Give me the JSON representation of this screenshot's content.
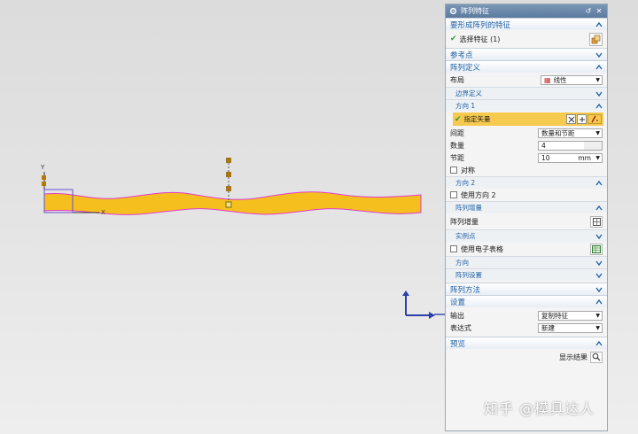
{
  "dialog": {
    "title": "阵列特征",
    "sections": {
      "features_to_pattern": "要形成阵列的特征",
      "select_feature": "选择特征 (1)",
      "reference_point": "参考点",
      "pattern_definition": "阵列定义",
      "layout_label": "布局",
      "layout_value": "线性",
      "boundary_definition": "边界定义",
      "direction1": "方向 1",
      "specify_vector": "指定矢量",
      "spacing_label": "间距",
      "spacing_value": "数量和节距",
      "count_label": "数量",
      "count_value": "4",
      "pitch_label": "节距",
      "pitch_value": "10",
      "pitch_unit": "mm",
      "symmetric": "对称",
      "direction2": "方向 2",
      "use_direction2": "使用方向 2",
      "pattern_increment": "阵列增量",
      "pattern_increment_row": "阵列增量",
      "instance_point": "实例点",
      "use_spreadsheet": "使用电子表格",
      "orientation": "方向",
      "pattern_settings": "阵列设置",
      "pattern_method": "阵列方法",
      "settings": "设置",
      "output_label": "输出",
      "output_value": "复制特征",
      "expression_label": "表达式",
      "expression_value": "新建",
      "preview": "预览",
      "show_result": "显示结果"
    }
  },
  "canvas": {
    "axis_x": "X",
    "axis_y": "Y"
  },
  "watermark": "知乎 @模具达人",
  "colors": {
    "part_fill": "#f5bf1e",
    "part_edge": "#e03ccc",
    "header_text": "#1d5fa4",
    "vector_highlight": "#f6c94f"
  }
}
